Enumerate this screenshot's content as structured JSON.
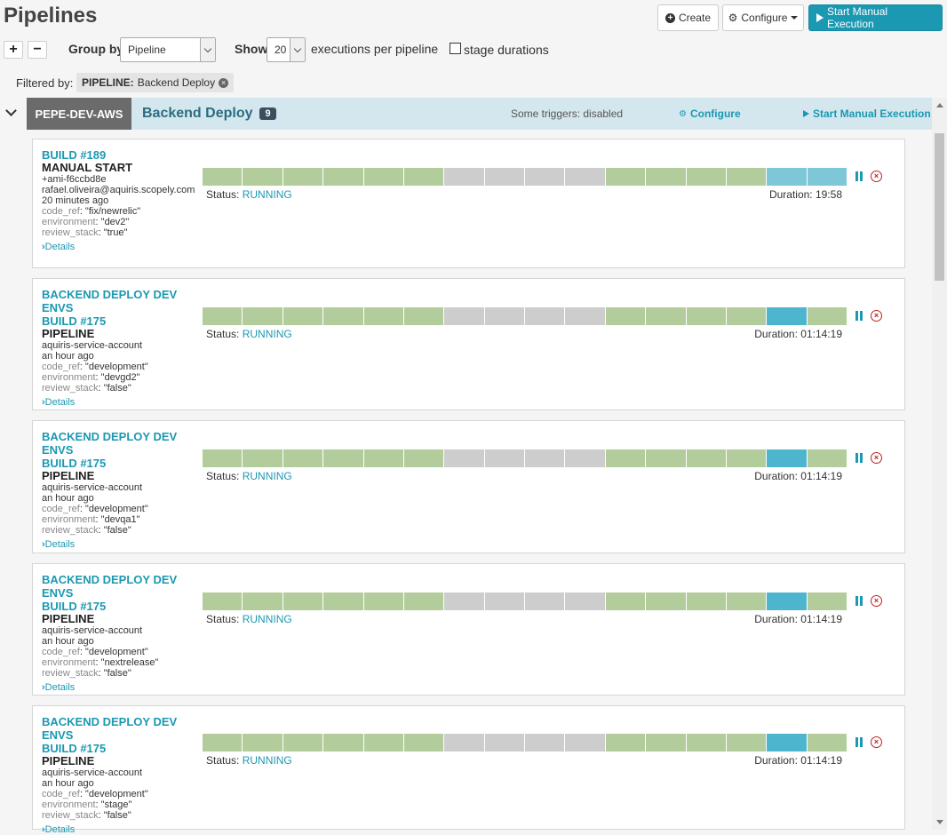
{
  "page": {
    "title": "Pipelines"
  },
  "toolbar": {
    "create_label": "Create",
    "configure_label": "Configure",
    "start_label": "Start Manual Execution"
  },
  "controls": {
    "group_by_label": "Group by",
    "group_by_value": "Pipeline",
    "show_label": "Show",
    "show_value": "20",
    "per_pipeline_label": "executions per pipeline",
    "stage_durations_label": "stage durations"
  },
  "filter": {
    "label": "Filtered by:",
    "chip_key": "PIPELINE:",
    "chip_value": "Backend Deploy"
  },
  "group": {
    "application": "PEPE-DEV-AWS",
    "title": "Backend Deploy",
    "count": "9",
    "status": "Some triggers: disabled",
    "configure_label": "Configure",
    "start_label": "Start Manual Execution"
  },
  "executions": [
    {
      "title_lines": [
        "BUILD #189"
      ],
      "trigger_type": "MANUAL START",
      "user_lines": [
        "+ami-f6ccbd8e",
        "rafael.oliveira@aquiris.scopely.com"
      ],
      "time": "20 minutes ago",
      "params": [
        {
          "key": "code_ref",
          "value": ": \"fix/newrelic\""
        },
        {
          "key": "environment",
          "value": ": \"dev2\""
        },
        {
          "key": "review_stack",
          "value": ": \"true\""
        }
      ],
      "details": "Details",
      "status_label": "Status:",
      "status": "RUNNING",
      "duration": "Duration: 19:58",
      "stages": [
        "s",
        "s",
        "s",
        "s",
        "s",
        "s",
        "n",
        "n",
        "n",
        "n",
        "s",
        "s",
        "s",
        "s",
        "r2",
        "r2"
      ]
    },
    {
      "title_lines": [
        "BACKEND DEPLOY DEV ENVS",
        "BUILD #175"
      ],
      "trigger_type": "PIPELINE",
      "user_lines": [
        "aquiris-service-account"
      ],
      "time": "an hour ago",
      "params": [
        {
          "key": "code_ref",
          "value": ": \"development\""
        },
        {
          "key": "environment",
          "value": ": \"devgd2\""
        },
        {
          "key": "review_stack",
          "value": ": \"false\""
        }
      ],
      "details": "Details",
      "status_label": "Status:",
      "status": "RUNNING",
      "duration": "Duration: 01:14:19",
      "stages": [
        "s",
        "s",
        "s",
        "s",
        "s",
        "s",
        "n",
        "n",
        "n",
        "n",
        "s",
        "s",
        "s",
        "s",
        "r",
        "s"
      ]
    },
    {
      "title_lines": [
        "BACKEND DEPLOY DEV ENVS",
        "BUILD #175"
      ],
      "trigger_type": "PIPELINE",
      "user_lines": [
        "aquiris-service-account"
      ],
      "time": "an hour ago",
      "params": [
        {
          "key": "code_ref",
          "value": ": \"development\""
        },
        {
          "key": "environment",
          "value": ": \"devqa1\""
        },
        {
          "key": "review_stack",
          "value": ": \"false\""
        }
      ],
      "details": "Details",
      "status_label": "Status:",
      "status": "RUNNING",
      "duration": "Duration: 01:14:19",
      "stages": [
        "s",
        "s",
        "s",
        "s",
        "s",
        "s",
        "n",
        "n",
        "n",
        "n",
        "s",
        "s",
        "s",
        "s",
        "r",
        "s"
      ]
    },
    {
      "title_lines": [
        "BACKEND DEPLOY DEV ENVS",
        "BUILD #175"
      ],
      "trigger_type": "PIPELINE",
      "user_lines": [
        "aquiris-service-account"
      ],
      "time": "an hour ago",
      "params": [
        {
          "key": "code_ref",
          "value": ": \"development\""
        },
        {
          "key": "environment",
          "value": ": \"nextrelease\""
        },
        {
          "key": "review_stack",
          "value": ": \"false\""
        }
      ],
      "details": "Details",
      "status_label": "Status:",
      "status": "RUNNING",
      "duration": "Duration: 01:14:19",
      "stages": [
        "s",
        "s",
        "s",
        "s",
        "s",
        "s",
        "n",
        "n",
        "n",
        "n",
        "s",
        "s",
        "s",
        "s",
        "r",
        "s"
      ]
    },
    {
      "title_lines": [
        "BACKEND DEPLOY DEV ENVS",
        "BUILD #175"
      ],
      "trigger_type": "PIPELINE",
      "user_lines": [
        "aquiris-service-account"
      ],
      "time": "an hour ago",
      "params": [
        {
          "key": "code_ref",
          "value": ": \"development\""
        },
        {
          "key": "environment",
          "value": ": \"stage\""
        },
        {
          "key": "review_stack",
          "value": ": \"false\""
        }
      ],
      "details": "Details",
      "status_label": "Status:",
      "status": "RUNNING",
      "duration": "Duration: 01:14:19",
      "stages": [
        "s",
        "s",
        "s",
        "s",
        "s",
        "s",
        "n",
        "n",
        "n",
        "n",
        "s",
        "s",
        "s",
        "s",
        "r",
        "s"
      ]
    }
  ]
}
